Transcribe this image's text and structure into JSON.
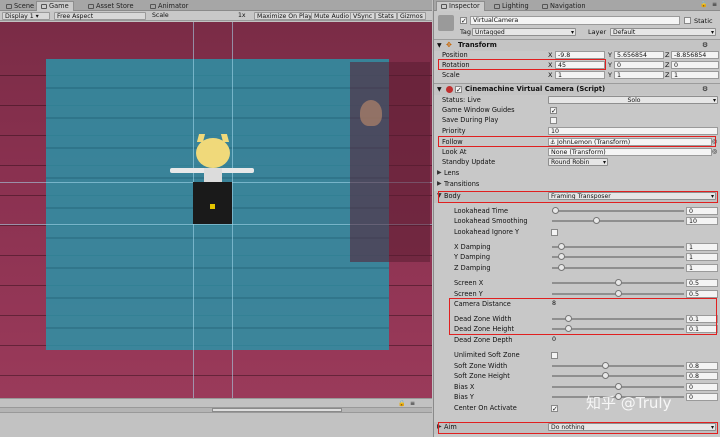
{
  "game_panel": {
    "tabs": [
      {
        "label": "Scene",
        "icon": "scene-icon"
      },
      {
        "label": "Game",
        "icon": "game-icon"
      },
      {
        "label": "Asset Store",
        "icon": "asset-store-icon"
      },
      {
        "label": "Animator",
        "icon": "animator-icon"
      }
    ],
    "toolbar": {
      "display": "Display 1",
      "aspect": "Free Aspect",
      "scale_label": "Scale",
      "scale_value": "1x",
      "maximize": "Maximize On Play",
      "mute": "Mute Audio",
      "vsync": "VSync",
      "stats": "Stats",
      "gizmos": "Gizmos"
    }
  },
  "inspector": {
    "tabs": [
      {
        "label": "Inspector",
        "icon": "inspector-icon"
      },
      {
        "label": "Lighting",
        "icon": "lighting-icon"
      },
      {
        "label": "Navigation",
        "icon": "navigation-icon"
      }
    ],
    "object": {
      "name": "VirtualCamera",
      "static_label": "Static",
      "tag_label": "Tag",
      "tag_value": "Untagged",
      "layer_label": "Layer",
      "layer_value": "Default"
    },
    "transform": {
      "title": "Transform",
      "position": {
        "label": "Position",
        "x": "-9.8",
        "y": "5.656854",
        "z": "-8.856854"
      },
      "rotation": {
        "label": "Rotation",
        "x": "45",
        "y": "0",
        "z": "0"
      },
      "scale": {
        "label": "Scale",
        "x": "1",
        "y": "1",
        "z": "1"
      }
    },
    "vcam": {
      "title": "Cinemachine Virtual Camera (Script)",
      "status_label": "Status: Live",
      "solo": "Solo",
      "game_window_guides": "Game Window Guides",
      "save_during_play": "Save During Play",
      "priority_label": "Priority",
      "priority_value": "10",
      "follow_label": "Follow",
      "follow_value": "JohnLemon (Transform)",
      "lookat_label": "Look At",
      "lookat_value": "None (Transform)",
      "standby_label": "Standby Update",
      "standby_value": "Round Robin",
      "lens": "Lens",
      "transitions": "Transitions",
      "body_label": "Body",
      "body_value": "Framing Transposer",
      "aim_label": "Aim",
      "aim_value": "Do nothing"
    },
    "body_props": [
      {
        "label": "Lookahead Time",
        "value": "0",
        "fill": 0.0
      },
      {
        "label": "Lookahead Smoothing",
        "value": "10",
        "fill": 0.33
      },
      {
        "label": "Lookahead Ignore Y",
        "checkbox": true
      },
      {
        "label": "X Damping",
        "value": "1",
        "fill": 0.05
      },
      {
        "label": "Y Damping",
        "value": "1",
        "fill": 0.05
      },
      {
        "label": "Z Damping",
        "value": "1",
        "fill": 0.05
      },
      {
        "label": "Screen X",
        "value": "0.5",
        "fill": 0.5
      },
      {
        "label": "Screen Y",
        "value": "0.5",
        "fill": 0.5
      },
      {
        "label": "Camera Distance",
        "value": "8",
        "field": true
      },
      {
        "label": "Dead Zone Width",
        "value": "0.1",
        "fill": 0.1
      },
      {
        "label": "Dead Zone Height",
        "value": "0.1",
        "fill": 0.1
      },
      {
        "label": "Dead Zone Depth",
        "value": "0",
        "field": true
      },
      {
        "label": "Unlimited Soft Zone",
        "checkbox": true
      },
      {
        "label": "Soft Zone Width",
        "value": "0.8",
        "fill": 0.4
      },
      {
        "label": "Soft Zone Height",
        "value": "0.8",
        "fill": 0.4
      },
      {
        "label": "Bias X",
        "value": "0",
        "fill": 0.5
      },
      {
        "label": "Bias Y",
        "value": "0",
        "fill": 0.5
      },
      {
        "label": "Center On Activate",
        "checkbox": true,
        "checked": true
      }
    ],
    "watermark": "知乎 @Truly"
  },
  "colors": {
    "soft_zone": "#2896aa",
    "hard_zone": "#c2185b",
    "highlight": "#e02020"
  }
}
